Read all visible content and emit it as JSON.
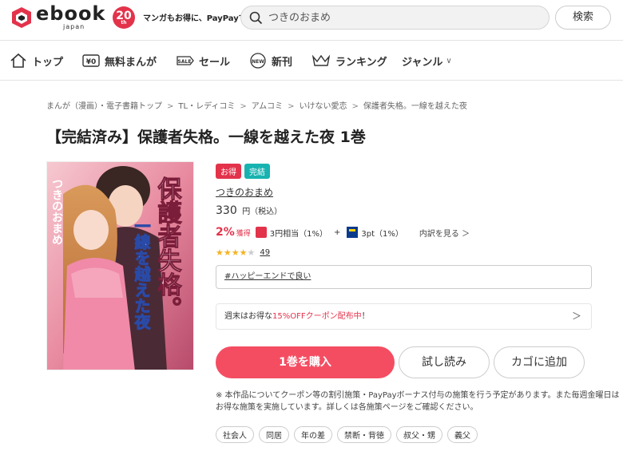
{
  "header": {
    "logo_text": "ebook",
    "logo_sub": "japan",
    "anniversary_badge": "20",
    "anniversary_sub": "th",
    "tagline": "マンガもお得に、PayPayで",
    "search_placeholder": "つきのおまめ",
    "search_button": "検索"
  },
  "nav": {
    "items": [
      {
        "label": "トップ",
        "icon": "home-icon"
      },
      {
        "label": "無料まんが",
        "icon": "free-icon"
      },
      {
        "label": "セール",
        "icon": "sale-tag-icon"
      },
      {
        "label": "新刊",
        "icon": "new-badge-icon"
      },
      {
        "label": "ランキング",
        "icon": "crown-icon"
      },
      {
        "label": "ジャンル",
        "icon": "chevron-down-icon"
      }
    ]
  },
  "breadcrumb": [
    "まんが（漫画）・電子書籍トップ",
    "TL・レディコミ",
    "アムコミ",
    "いけない愛恋",
    "保護者失格。一線を越えた夜"
  ],
  "product": {
    "title": "【完結済み】保護者失格。一線を越えた夜 1巻",
    "tags": [
      {
        "label": "お得",
        "color": "#e3334b"
      },
      {
        "label": "完結",
        "color": "#18b3b0"
      }
    ],
    "author": "つきのおまめ",
    "price": "330",
    "price_unit": "円（税込）",
    "points": {
      "percent": "2%",
      "earn_label": "獲得",
      "paypay": "3円相当（1%）",
      "plus": "+",
      "tpoint": "3pt（1%）",
      "breakdown": "内訳を見る ＞"
    },
    "rating": {
      "stars": 4,
      "max": 5,
      "count": "49"
    },
    "hashtag": "#ハッピーエンドで良い",
    "coupon": {
      "prefix": "週末はお得な",
      "highlight": "15%OFFクーポン配布中",
      "suffix": "！",
      "arrow": "＞"
    },
    "buttons": {
      "buy": "1巻を購入",
      "trial": "試し読み",
      "cart": "カゴに追加"
    },
    "note": "※ 本作品についてクーポン等の割引施策・PayPayボーナス付与の施策を行う予定があります。また毎週金曜日はお得な施策を実施しています。詳しくは各施策ページをご確認ください。",
    "genres": [
      "社会人",
      "同居",
      "年の差",
      "禁断・背徳",
      "叔父・甥",
      "義父"
    ]
  },
  "cover": {
    "author_vertical": "つきのおまめ",
    "title_vertical_1": "保護者失格。",
    "title_vertical_2": "一線を越えた夜"
  }
}
